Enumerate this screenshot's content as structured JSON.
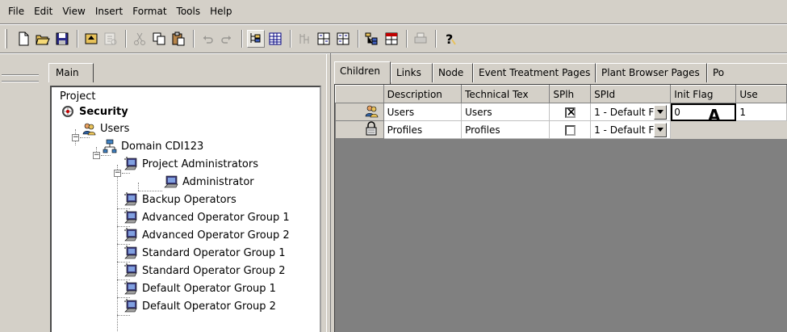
{
  "menu": [
    "File",
    "Edit",
    "View",
    "Insert",
    "Format",
    "Tools",
    "Help"
  ],
  "toolbar": {
    "buttons": [
      "new-icon",
      "open-icon",
      "save-icon",
      "up-level-icon",
      "properties-icon",
      "cut-icon",
      "copy-icon",
      "paste-icon",
      "undo-icon",
      "redo-icon",
      "tree-view-icon",
      "grid-view-icon",
      "node-icon",
      "expand-icon",
      "collapse-icon",
      "hierarchy-icon",
      "table-icon",
      "print-icon",
      "help-icon"
    ]
  },
  "left_panel": {
    "tab_label": "Main",
    "tree": [
      {
        "label": "Project",
        "icon": "none",
        "bold": false
      },
      {
        "label": "Security",
        "icon": "security-icon",
        "bold": true
      },
      {
        "label": "Users",
        "icon": "users-icon",
        "bold": false
      },
      {
        "label": "Domain CDI123",
        "icon": "domain-icon",
        "bold": false
      },
      {
        "label": "Project Administrators",
        "icon": "group-icon",
        "bold": false
      },
      {
        "label": "Administrator",
        "icon": "user-computer-icon",
        "bold": false
      },
      {
        "label": "Backup Operators",
        "icon": "group-icon",
        "bold": false
      },
      {
        "label": "Advanced Operator Group 1",
        "icon": "group-icon",
        "bold": false
      },
      {
        "label": "Advanced Operator Group 2",
        "icon": "group-icon",
        "bold": false
      },
      {
        "label": "Standard Operator Group 1",
        "icon": "group-icon",
        "bold": false
      },
      {
        "label": "Standard Operator Group 2",
        "icon": "group-icon",
        "bold": false
      },
      {
        "label": "Default Operator Group 1",
        "icon": "group-icon",
        "bold": false
      },
      {
        "label": "Default Operator Group 2",
        "icon": "group-icon",
        "bold": false
      }
    ]
  },
  "right_panel": {
    "tabs": [
      "Children",
      "Links",
      "Node",
      "Event Treatment Pages",
      "Plant Browser Pages",
      "Po"
    ],
    "active_tab": "Children",
    "columns": [
      "",
      "Description",
      "Technical Tex",
      "SPlh",
      "SPId",
      "Init Flag",
      "Use"
    ],
    "rows": [
      {
        "icon": "users-icon",
        "description": "Users",
        "technical": "Users",
        "splh_checked": true,
        "spid": "1 - Default F",
        "init_flag": "0",
        "use": "1"
      },
      {
        "icon": "lock-icon",
        "description": "Profiles",
        "technical": "Profiles",
        "splh_checked": false,
        "spid": "1 - Default F",
        "init_flag": "",
        "use": ""
      }
    ],
    "annotation": "A"
  }
}
